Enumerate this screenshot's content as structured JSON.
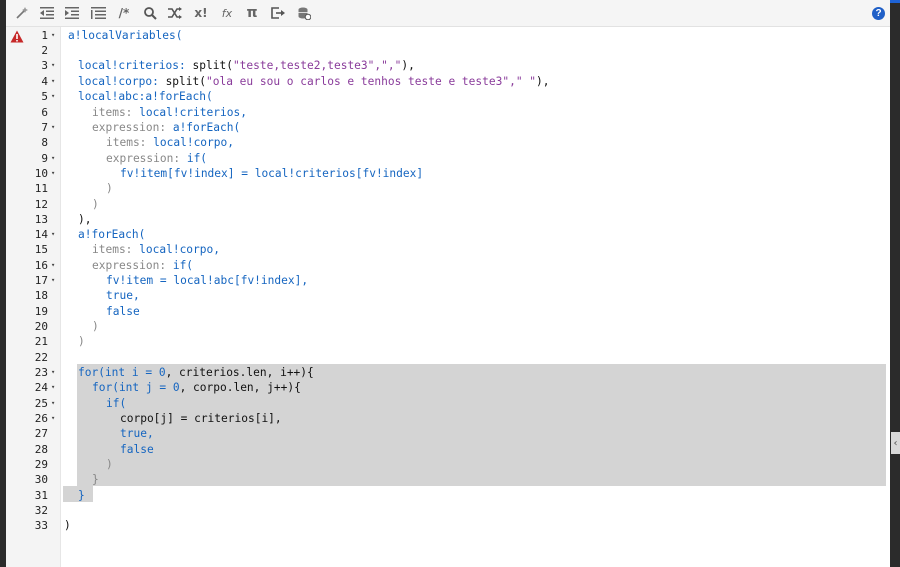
{
  "toolbar": {
    "icons": [
      "magic-wand-icon",
      "outdent-icon",
      "indent-icon",
      "format-list-icon",
      "comment-icon",
      "search-icon",
      "shuffle-icon",
      "expression-icon",
      "function-icon",
      "pi-icon",
      "export-icon",
      "database-icon"
    ],
    "comment_glyph": "/*",
    "expr_glyph": "x!",
    "fx_glyph": "fx",
    "pi_glyph": "π",
    "help_glyph": "?"
  },
  "line_numbers": [
    "1",
    "2",
    "3",
    "4",
    "5",
    "6",
    "7",
    "8",
    "9",
    "10",
    "11",
    "12",
    "13",
    "14",
    "15",
    "16",
    "17",
    "18",
    "19",
    "20",
    "21",
    "22",
    "23",
    "24",
    "25",
    "26",
    "27",
    "28",
    "29",
    "30",
    "31",
    "32",
    "33"
  ],
  "fold_marker": "▾",
  "code": {
    "l1": [
      "a!localVariables("
    ],
    "l3": [
      "local!criterios: ",
      "split(",
      "\"teste,teste2,teste3\",\",\"",
      "),"
    ],
    "l4": [
      "local!corpo: ",
      "split(",
      "\"ola eu sou o carlos e tenhos teste e teste3\",\" \"",
      "),"
    ],
    "l5": [
      "local!abc:",
      "a!forEach("
    ],
    "l6": [
      "items: ",
      "local!criterios,"
    ],
    "l7": [
      "expression: ",
      "a!forEach("
    ],
    "l8": [
      "items: ",
      "local!corpo,"
    ],
    "l9": [
      "expression: ",
      "if("
    ],
    "l10": [
      "fv!item[fv!index] = local!criterios[fv!index]"
    ],
    "l11": [
      ")"
    ],
    "l12": [
      ")"
    ],
    "l13": [
      "),"
    ],
    "l14": [
      "a!forEach("
    ],
    "l15": [
      "items: ",
      "local!corpo,"
    ],
    "l16": [
      "expression: ",
      "if("
    ],
    "l17": [
      "fv!item = local!abc[fv!index],"
    ],
    "l18": [
      "true,"
    ],
    "l19": [
      "false"
    ],
    "l20": [
      ")"
    ],
    "l21": [
      ")"
    ],
    "l23": [
      "for(int i = ",
      "0",
      ", criterios.len, i++){"
    ],
    "l24": [
      "for(int j = ",
      "0",
      ", corpo.len, j++){"
    ],
    "l25": [
      "if("
    ],
    "l26": [
      "corpo[j] = criterios[i],"
    ],
    "l27": [
      "true,"
    ],
    "l28": [
      "false"
    ],
    "l29": [
      ")"
    ],
    "l30": [
      "}"
    ],
    "l31": [
      "}"
    ],
    "l33": [
      ")"
    ]
  },
  "colors": {
    "keyword": "#1565c0",
    "string": "#8a3c9b",
    "warning": "#c62828",
    "selection": "#d4d4d4"
  }
}
